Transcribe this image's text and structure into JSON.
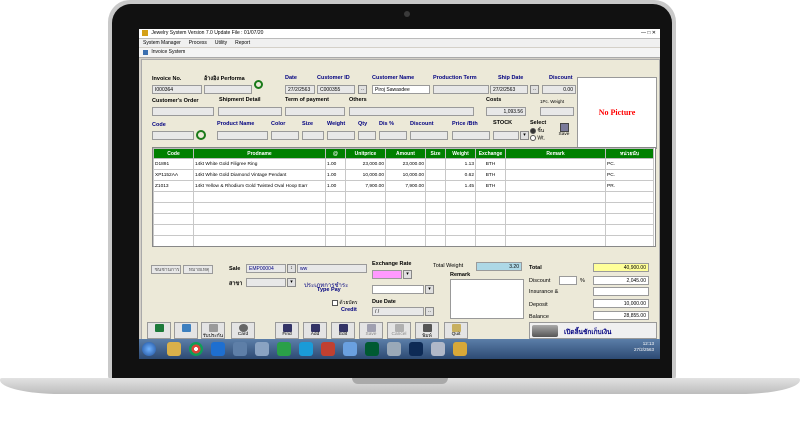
{
  "window": {
    "title": "Jewelry System Version 7.0 Update File : 01/07/20"
  },
  "menu": [
    "System Manager",
    "Process",
    "Utility",
    "Report"
  ],
  "form_title": "Invoice System",
  "header": {
    "invoice_no_label": "Invoice No.",
    "invoice_no": "I000364",
    "performa_label": "อ้างอิง Performa",
    "date_label": "Date",
    "date": "27/2/2563",
    "customer_id_label": "Customer ID",
    "customer_id": "C000355",
    "customer_name_label": "Customer Name",
    "customer_name": "Piroj Sawasdee",
    "production_term_label": "Production Term",
    "ship_date_label": "Ship Date",
    "ship_date": "27/2/2563",
    "discount_label": "Discount",
    "discount": "0.00",
    "customers_order_label": "Customer's Order",
    "shipment_detail_label": "Shipment Detail",
    "term_of_payment_label": "Term of payment",
    "others_label": "Others",
    "costs_label": "Costs",
    "costs": "1,093.56",
    "pc_weight_label": "1Pc. Weight"
  },
  "no_picture": "No Picture",
  "item_entry": {
    "code_label": "Code",
    "product_name_label": "Product Name",
    "color_label": "Color",
    "size_label": "Size",
    "weight_label": "Weight",
    "qty_label": "Qty",
    "disc_label": "Dis %",
    "discount_label": "Discount",
    "price_label": "Price /Bth",
    "stock_label": "STOCK",
    "select_label": "Select",
    "opt_piece": "ชิ้น",
    "opt_wt": "Wt.",
    "save_label": "Save"
  },
  "table": {
    "columns": [
      "Code",
      "Prodname",
      "@",
      "Unitprice",
      "Amount",
      "Size",
      "Weight",
      "Exchange",
      "Remark",
      "หน่วยนับ"
    ],
    "rows": [
      [
        "D1891",
        "14kt White Gold Filigree Ring",
        "1.00",
        "23,000.00",
        "23,000.00",
        "",
        "1.13",
        "BTH",
        "",
        "PC."
      ],
      [
        "XP1152AA",
        "14kt White Gold Diamond Vintage Pendant",
        "1.00",
        "10,000.00",
        "10,000.00",
        "",
        "0.62",
        "BTH",
        "",
        "PC."
      ],
      [
        "Z1013",
        "14kt Yellow & Rhodium Gold Twisted Oval Hoop Earr",
        "1.00",
        "7,900.00",
        "7,900.00",
        "",
        "1.45",
        "BTH",
        "",
        "PR."
      ]
    ]
  },
  "bottom": {
    "btn_left1": "ชนชานการ",
    "btn_left2": "หมายเหตุ",
    "sale_label": "Sale",
    "sale_code": "EMP00004",
    "sale_name": "ww",
    "branch_label": "สาขา",
    "payment_th": "ประเภทการชำระ",
    "type_pay_label": "Type Pay",
    "credit_th": "ด้วยบัตร",
    "credit_label": "Credit",
    "exchange_rate_label": "Exchange Rate",
    "total_weight_label": "Total Weight",
    "total_weight": "3.20",
    "remark_label": "Remark",
    "due_date_label": "Due Date",
    "due_date": "/ /",
    "total_label": "Total",
    "total": "40,900.00",
    "discount_label": "Discount",
    "discount": "2,045.00",
    "percent_sign": "%",
    "insurance_label": "Insurance &",
    "insurance": "10,000.00",
    "deposit_label": "Deposit",
    "balance_label": "Balance",
    "balance": "28,855.00",
    "open_drawer": "เปิดลิ้นชักเก็บเงิน"
  },
  "toolbar": {
    "card": "Card",
    "receipt": "รับประกัน",
    "find": "Find",
    "add": "Add",
    "edit": "Edit",
    "save": "Save",
    "cancel": "Cancel",
    "print": "พิมพ์",
    "quit": "Quit"
  },
  "taskbar": {
    "time": "12:13",
    "date": "27/2/2563"
  }
}
